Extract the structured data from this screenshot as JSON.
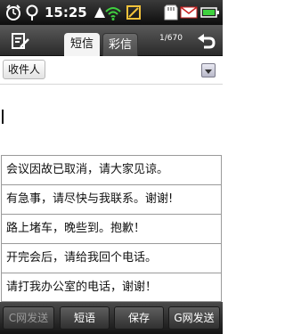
{
  "status_bar": {
    "time": "15:25",
    "icons": [
      "alarm-clock-icon",
      "location-pin-icon",
      "status-arrow-icon",
      "wifi-icon",
      "music-note-icon",
      "sd-card-icon",
      "mail-icon",
      "battery-icon"
    ]
  },
  "header": {
    "tabs": [
      {
        "label": "短信",
        "active": true
      },
      {
        "label": "彩信",
        "active": false
      }
    ],
    "message_counter": "1/670",
    "icons": [
      "compose-icon",
      "back-arrow-icon"
    ]
  },
  "recipient": {
    "button_label": "收件人",
    "value": ""
  },
  "message": {
    "body": ""
  },
  "quick_phrases": [
    "会议因故已取消，请大家见谅。",
    "有急事，请尽快与我联系。谢谢!",
    "路上堵车，晚些到。抱歉！",
    "开完会后，请给我回个电话。",
    "请打我办公室的电话，谢谢！"
  ],
  "toolbar": {
    "buttons": [
      {
        "label": "C网发送",
        "enabled": false
      },
      {
        "label": "短语",
        "enabled": true
      },
      {
        "label": "保存",
        "enabled": true
      },
      {
        "label": "G网发送",
        "enabled": true
      }
    ]
  },
  "colors": {
    "status_bar": "#0d0d0d",
    "header": "#3a3a3a",
    "toolbar": "#2a2a2a",
    "active_tab": "#f4f4f4",
    "disabled_text": "#9a9a9a"
  }
}
